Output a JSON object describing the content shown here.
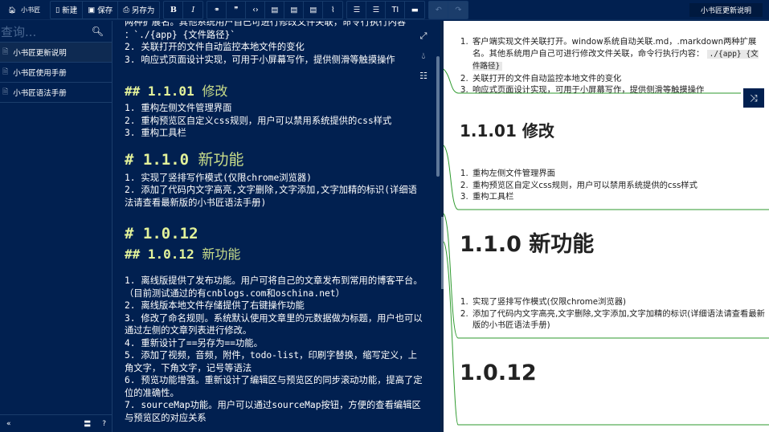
{
  "toolbar": {
    "brand": "小书匠",
    "new_label": "新建",
    "save_label": "保存",
    "saveas_label": "另存为",
    "title": "小书匠更新说明"
  },
  "sidebar": {
    "search_placeholder": "查询...",
    "items": [
      {
        "label": "小书匠更新说明"
      },
      {
        "label": "小书匠使用手册"
      },
      {
        "label": "小书匠语法手册"
      }
    ],
    "footer": {
      "collapse": "«",
      "menu": "〓",
      "help": "?"
    }
  },
  "editor": {
    "lines_top": [
      "两种扩展名。其他系统用户自己可进行修改文件关联，命令行执行内容",
      "：`./{app} {文件路径}`",
      "2. 关联打开的文件自动监控本地文件的变化",
      "3. 响应式页面设计实现，可用于小屏幕写作，提供侧滑等触摸操作"
    ],
    "h_1101_mark": "## 1.1.01",
    "h_1101_text": "修改",
    "list_1101": [
      "1. 重构左侧文件管理界面",
      "2. 重构预览区自定义css规则，用户可以禁用系统提供的css样式",
      "3. 重构工具栏"
    ],
    "h_110_mark": "# 1.1.0",
    "h_110_text": "新功能",
    "list_110": [
      "1. 实现了竖排写作模式(仅限chrome浏览器)",
      "2. 添加了代码内文字高亮,文字删除,文字添加,文字加精的标识(详细语法请查看最新版的小书匠语法手册)"
    ],
    "h_1012": "# 1.0.12",
    "h2_1012_mark": "## 1.0.12",
    "h2_1012_text": "新功能",
    "list_1012": [
      "1. 离线版提供了发布功能。用户可将自己的文章发布到常用的博客平台。（目前测试通过的有cnblogs.com和oschina.net）",
      "2. 离线版本地文件存储提供了右键操作功能",
      "3. 修改了命名规则。系统默认使用文章里的元数据做为标题，用户也可以通过左侧的文章列表进行修改。",
      "4. 重新设计了==另存为==功能。",
      "5. 添加了视频，音频，附件，todo-list，印刷字替换，缩写定义，上角文字，下角文字，记号等语法",
      "6. 预览功能增强。重新设计了编辑区与预览区的同步滚动功能，提高了定位的准确性。",
      "7. sourceMap功能。用户可以通过sourceMap按钮，方便的查看编辑区与预览区的对应关系"
    ]
  },
  "preview": {
    "list_top": [
      "客户端实现文件关联打开。window系统自动关联.md，.markdown两种扩展名。其他系统用户自己可进行修改文件关联，命令行执行内容：",
      "关联打开的文件自动监控本地文件的变化",
      "响应式页面设计实现，可用于小屏幕写作，提供侧滑等触摸操作"
    ],
    "code_top": "./{app} {文件路径}",
    "h_1101": "1.1.01 修改",
    "list_1101": [
      "重构左侧文件管理界面",
      "重构预览区自定义css规则，用户可以禁用系统提供的css样式",
      "重构工具栏"
    ],
    "h_110": "1.1.0 新功能",
    "list_110": [
      "实现了竖排写作模式(仅限chrome浏览器)",
      "添加了代码内文字高亮,文字删除,文字添加,文字加精的标识(详细语法请查看最新版的小书匠语法手册)"
    ],
    "h_1012": "1.0.12"
  },
  "colors": {
    "bg": "#012050",
    "heading": "#e3f29a",
    "sourcemap": "#2e9a2e"
  }
}
